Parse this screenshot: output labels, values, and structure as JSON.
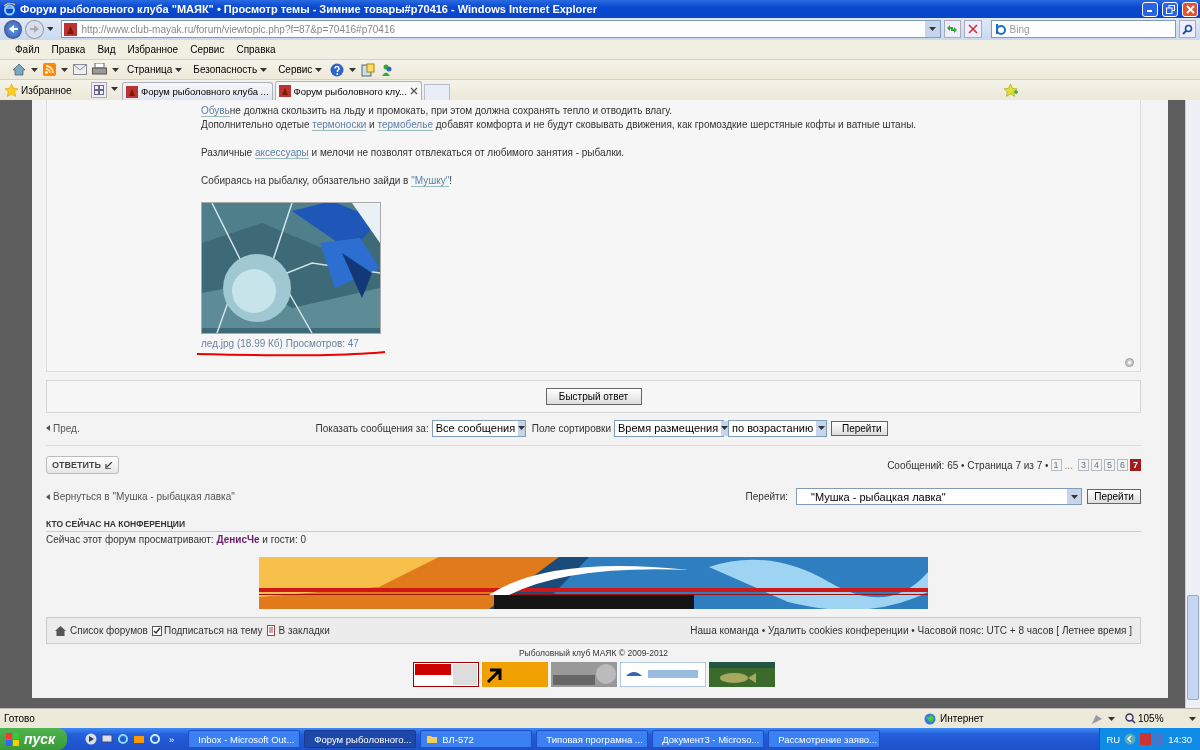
{
  "window": {
    "title": "Форум рыболовного клуба \"МАЯК\" • Просмотр темы - Зимние товары#p70416 - Windows Internet Explorer"
  },
  "address_bar": {
    "url": "http://www.club-mayak.ru/forum/viewtopic.php?f=87&p=70416#p70416"
  },
  "search": {
    "placeholder": "Bing"
  },
  "menu": [
    "Файл",
    "Правка",
    "Вид",
    "Избранное",
    "Сервис",
    "Справка"
  ],
  "command_bar": [
    "Страница",
    "Безопасность",
    "Сервис"
  ],
  "favorites": "Избранное",
  "tabs": [
    {
      "label": "Форум рыболовного клуба ...",
      "selected": false
    },
    {
      "label": "Форум рыболовного клу...",
      "selected": true
    }
  ],
  "post": {
    "paragraphs": [
      [
        [
          {
            "text": "Обувь",
            "link": true
          },
          {
            "text": "не должна скользить на льду и промокать, при этом должна сохранять тепло и отводить влагу."
          }
        ],
        [
          {
            "text": "Дополнительно одетые "
          },
          {
            "text": "термоноски",
            "link": true
          },
          {
            "text": " и "
          },
          {
            "text": "термобелье",
            "link": true
          },
          {
            "text": " добавят комфорта и не будут сковывать движения, как громоздкие шерстяные кофты и ватные штаны."
          }
        ]
      ],
      [
        [
          {
            "text": "Различные "
          },
          {
            "text": "аксессуары",
            "link": true
          },
          {
            "text": " и мелочи не позволят отвлекаться от любимого занятия - рыбалки."
          }
        ]
      ],
      [
        [
          {
            "text": "Собираясь на рыбалку, обязательно зайди в "
          },
          {
            "text": "\"Мушку\"",
            "link": true
          },
          {
            "text": "!"
          }
        ]
      ]
    ],
    "caption": "лед.jpg (18.99 Кб) Просмотров: 47"
  },
  "quick_reply": "Быстрый ответ",
  "sort_bar": {
    "prev": "Пред.",
    "show_label": "Показать сообщения за:",
    "show_value": "Все сообщения",
    "sort_label": "Поле сортировки",
    "sort_value": "Время размещения",
    "order_value": "по возрастанию",
    "button": "Перейти"
  },
  "reply_button": "ОТВЕТИТЬ",
  "pagination": {
    "summary": "Сообщений: 65 • Страница 7 из 7 •",
    "pages": [
      {
        "label": "1",
        "kind": "page",
        "selected": false
      },
      {
        "label": "...",
        "kind": "gap",
        "selected": false
      },
      {
        "label": "3",
        "kind": "page",
        "selected": false
      },
      {
        "label": "4",
        "kind": "page",
        "selected": false
      },
      {
        "label": "5",
        "kind": "page",
        "selected": false
      },
      {
        "label": "6",
        "kind": "page",
        "selected": false
      },
      {
        "label": "7",
        "kind": "page",
        "selected": true
      }
    ]
  },
  "jump": {
    "back": "Вернуться в \"Мушка - рыбацкая лавка\"",
    "label": "Перейти:",
    "value": "\"Мушка - рыбацкая лавка\"",
    "button": "Перейти"
  },
  "online": {
    "heading": "КТО СЕЙЧАС НА КОНФЕРЕНЦИИ",
    "text": [
      {
        "text": "Сейчас этот форум просматривают: "
      },
      {
        "text": "ДенисЧе",
        "link": true
      },
      {
        "text": " и гости: 0"
      }
    ]
  },
  "footer_nav": {
    "home": "Список форумов",
    "subscribe": {
      "label": "Подписаться на тему",
      "checked": true
    },
    "bookmark": "В закладки",
    "right": [
      {
        "text": "Наша команда",
        "link": true
      },
      {
        "text": " • "
      },
      {
        "text": "Удалить cookies конференции",
        "link": true
      },
      {
        "text": " • Часовой пояс: UTC + 8 часов [ Летнее время ]"
      }
    ]
  },
  "copyright": "Рыболовный клуб МАЯК © 2009-2012",
  "status_bar": {
    "text": "Готово",
    "zone": "Интернет",
    "zoom": "105%"
  },
  "taskbar": {
    "start": "пуск",
    "more": "»",
    "items": [
      {
        "label": "Inbox - Microsoft Out...",
        "kind": "mail",
        "selected": false
      },
      {
        "label": "Форум рыболовного...",
        "kind": "browser",
        "selected": true
      },
      {
        "label": "ВЛ-572",
        "kind": "folder",
        "selected": false
      },
      {
        "label": "Типовая програмна ...",
        "kind": "document",
        "selected": false
      },
      {
        "label": "Документ3 - Microso...",
        "kind": "document",
        "selected": false
      },
      {
        "label": "Рассмотрение заяво...",
        "kind": "app",
        "selected": false
      }
    ],
    "language": "RU",
    "time": "14:30"
  }
}
